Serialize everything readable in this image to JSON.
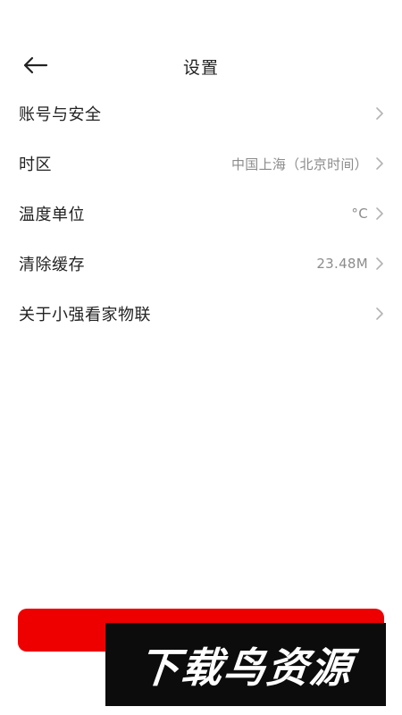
{
  "header": {
    "title": "设置",
    "back_icon": "arrow-left-icon"
  },
  "settings": [
    {
      "label": "账号与安全",
      "value": ""
    },
    {
      "label": "时区",
      "value": "中国上海（北京时间）"
    },
    {
      "label": "温度单位",
      "value": "°C"
    },
    {
      "label": "清除缓存",
      "value": "23.48M"
    },
    {
      "label": "关于小强看家物联",
      "value": ""
    }
  ],
  "chevron_icon": "chevron-right-icon",
  "primary_button": {
    "label": "",
    "color": "#ee0000"
  },
  "watermark": {
    "text": "下载鸟资源"
  }
}
